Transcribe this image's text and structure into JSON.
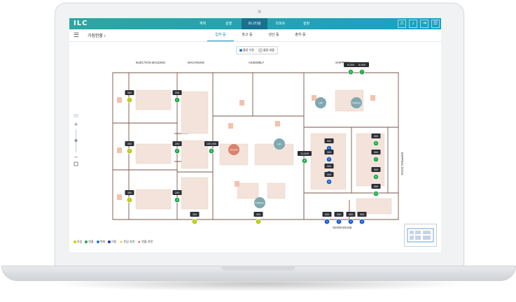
{
  "app": {
    "logo": "ILC"
  },
  "topnav": {
    "items": [
      "계획",
      "실행",
      "모니터링",
      "리포트",
      "설정"
    ],
    "active_index": 2
  },
  "subbar": {
    "title": "거점현황",
    "chevron": "›",
    "tabs": [
      "입하 동",
      "창고 동",
      "생산 동",
      "출하 동"
    ],
    "active_index": 0
  },
  "toggle": {
    "option1": "물류 수량",
    "option2": "물류 비중"
  },
  "zones": {
    "injection": "INJECTION MOLDING",
    "machining": "MACHINING",
    "assembly": "ASSEMBLY",
    "shipping": "SHIPPING",
    "warehouse": "WAREHOUSE",
    "shipping_dock": "SHIPPING DOCK"
  },
  "robots": {
    "uk1": "UR",
    "fanuc1": "FANUC",
    "kuka": "KUKA",
    "uk2": "UR",
    "fanuc2": "FANUC"
  },
  "qty_badges": [
    {
      "value": "300",
      "num": "1",
      "status": "yellow"
    },
    {
      "value": "200",
      "num": "1",
      "status": "green"
    },
    {
      "value": "300",
      "num": "2",
      "status": "yellow"
    },
    {
      "value": "200",
      "num": "2",
      "status": "green"
    },
    {
      "value": "100,000",
      "num": "4",
      "status": "green"
    },
    {
      "value": "300",
      "num": "3",
      "status": "yellow"
    },
    {
      "value": "200",
      "num": "3",
      "status": "green"
    },
    {
      "value": "300",
      "num": "4",
      "status": "yellow"
    },
    {
      "value": "300",
      "num": "2",
      "status": "yellow"
    },
    {
      "value": "5,000",
      "num": "6",
      "status": "green"
    },
    {
      "value": "5,000",
      "num": "7",
      "status": "green"
    },
    {
      "value": "11,000",
      "num": "5",
      "status": "green"
    },
    {
      "value": "300",
      "num": "1",
      "status": "blue"
    },
    {
      "value": "300",
      "num": "2",
      "status": "blue"
    },
    {
      "value": "300",
      "num": "3",
      "status": "blue"
    },
    {
      "value": "300",
      "num": "5",
      "status": "blue"
    },
    {
      "value": "300",
      "num": "6",
      "status": "green"
    },
    {
      "value": "300",
      "num": "7",
      "status": "green"
    },
    {
      "value": "300",
      "num": "8",
      "status": "green"
    },
    {
      "value": "300",
      "num": "9",
      "status": "green"
    },
    {
      "value": "300",
      "num": "1",
      "status": "blue"
    },
    {
      "value": "300",
      "num": "2",
      "status": "blue"
    },
    {
      "value": "300",
      "num": "3",
      "status": "blue"
    },
    {
      "value": "300",
      "num": "4",
      "status": "blue"
    }
  ],
  "legend": [
    {
      "label": "투입",
      "color": "#c7d400",
      "shape": "dot"
    },
    {
      "label": "반출",
      "color": "#22a84a",
      "shape": "dot"
    },
    {
      "label": "적재",
      "color": "#1a7fc9",
      "shape": "dot"
    },
    {
      "label": "이동",
      "color": "#1a3f9c",
      "shape": "dot"
    },
    {
      "label": "투입 지연",
      "color": "#f0a500",
      "shape": "triangle"
    },
    {
      "label": "반출 지연",
      "color": "#d9342b",
      "shape": "triangle"
    }
  ],
  "colors": {
    "yellow": "#b6cc00",
    "green": "#22a84a",
    "blue": "#1a5fc9",
    "topbar_start": "#2ca6a0",
    "topbar_end": "#1aa1c6",
    "wall": "#7a5548",
    "robot_teal": "#7fa8b0",
    "robot_orange": "#d9826b"
  }
}
